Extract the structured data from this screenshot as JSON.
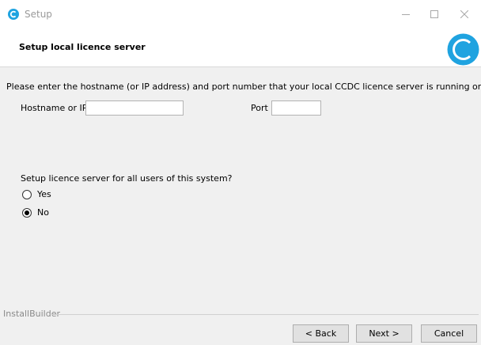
{
  "window": {
    "title": "Setup"
  },
  "header": {
    "title": "Setup local licence server"
  },
  "intro": "Please enter the hostname (or IP address) and port number that your local CCDC licence server is running on.",
  "fields": {
    "hostname_label": "Hostname or IP",
    "hostname_value": "",
    "port_label": "Port",
    "port_value": ""
  },
  "all_users": {
    "question": "Setup licence server for all users of this system?",
    "options": [
      {
        "label": "Yes",
        "selected": false
      },
      {
        "label": "No",
        "selected": true
      }
    ]
  },
  "footer": {
    "brand": "InstallBuilder",
    "back_label": "< Back",
    "next_label": "Next >",
    "cancel_label": "Cancel"
  },
  "colors": {
    "brand_blue": "#1fa3e0",
    "panel_bg": "#f0f0f0"
  },
  "icons": [
    "ccdc-logo-icon",
    "minimize-icon",
    "maximize-icon",
    "close-icon"
  ]
}
